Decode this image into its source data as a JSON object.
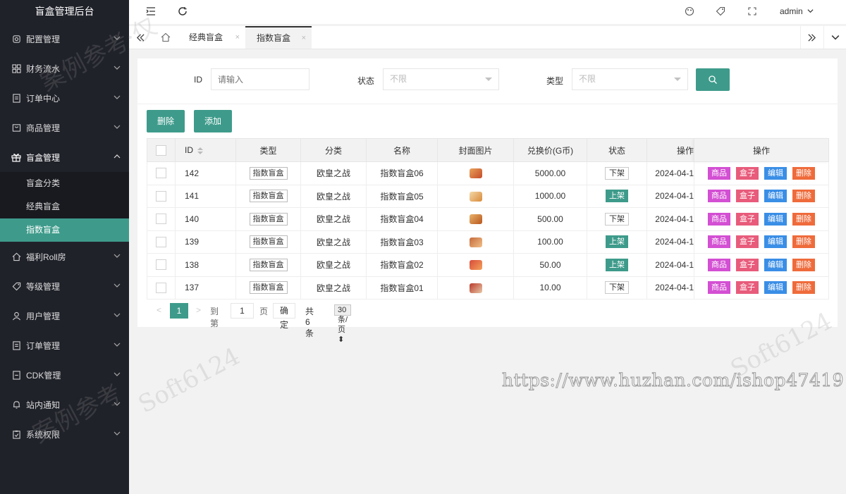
{
  "app": {
    "title": "盲盒管理后台"
  },
  "sidebar": {
    "items": [
      {
        "label": "配置管理",
        "icon": "gear-icon"
      },
      {
        "label": "财务流水",
        "icon": "grid-icon"
      },
      {
        "label": "订单中心",
        "icon": "doc-icon"
      },
      {
        "label": "商品管理",
        "icon": "bag-icon"
      },
      {
        "label": "盲盒管理",
        "icon": "gift-icon"
      },
      {
        "label": "福利Roll房",
        "icon": "home-icon"
      },
      {
        "label": "等级管理",
        "icon": "tag-icon"
      },
      {
        "label": "用户管理",
        "icon": "user-icon"
      },
      {
        "label": "订单管理",
        "icon": "doc-icon"
      },
      {
        "label": "CDK管理",
        "icon": "card-icon"
      },
      {
        "label": "站内通知",
        "icon": "bell-icon"
      },
      {
        "label": "系统权限",
        "icon": "clipboard-icon"
      }
    ],
    "sub_items": [
      "盲盒分类",
      "经典盲盒",
      "指数盲盒"
    ]
  },
  "header": {
    "user": "admin"
  },
  "tabs": [
    {
      "label": "经典盲盒"
    },
    {
      "label": "指数盲盒"
    }
  ],
  "tab_close": "×",
  "filters": {
    "id_label": "ID",
    "id_placeholder": "请输入",
    "status_label": "状态",
    "status_value": "不限",
    "type_label": "类型",
    "type_value": "不限"
  },
  "toolbar": {
    "delete_label": "删除",
    "add_label": "添加"
  },
  "table": {
    "headers": [
      "ID",
      "类型",
      "分类",
      "名称",
      "封面图片",
      "兑换价(G币)",
      "状态",
      "操作",
      "操作"
    ],
    "rows": [
      {
        "id": "142",
        "type": "指数盲盒",
        "category": "欧皇之战",
        "name": "指数盲盒06",
        "price": "5000.00",
        "status": "下架",
        "date": "2024-04-1"
      },
      {
        "id": "141",
        "type": "指数盲盒",
        "category": "欧皇之战",
        "name": "指数盲盒05",
        "price": "1000.00",
        "status": "上架",
        "date": "2024-04-1"
      },
      {
        "id": "140",
        "type": "指数盲盒",
        "category": "欧皇之战",
        "name": "指数盲盒04",
        "price": "500.00",
        "status": "下架",
        "date": "2024-04-1"
      },
      {
        "id": "139",
        "type": "指数盲盒",
        "category": "欧皇之战",
        "name": "指数盲盒03",
        "price": "100.00",
        "status": "上架",
        "date": "2024-04-1"
      },
      {
        "id": "138",
        "type": "指数盲盒",
        "category": "欧皇之战",
        "name": "指数盲盒02",
        "price": "50.00",
        "status": "上架",
        "date": "2024-04-1"
      },
      {
        "id": "137",
        "type": "指数盲盒",
        "category": "欧皇之战",
        "name": "指数盲盒01",
        "price": "10.00",
        "status": "下架",
        "date": "2024-04-1"
      }
    ],
    "actions": [
      {
        "label": "商品",
        "color": "#d34fd3"
      },
      {
        "label": "盒子",
        "color": "#e85b7b"
      },
      {
        "label": "编辑",
        "color": "#3a8ee6"
      },
      {
        "label": "删除",
        "color": "#ef6b3b"
      }
    ]
  },
  "pager": {
    "current": "1",
    "goto_label": "到第",
    "goto_value": "1",
    "page_label": "页",
    "confirm_label": "确定",
    "total_label": "共 6 条",
    "per_page": "30 条/页"
  },
  "watermark": {
    "url": "https://www.huzhan.com/ishop47419",
    "text1": "案例参考·仅",
    "text2": "Soft6124",
    "text3": "案例参考",
    "text4": "Soft6124"
  },
  "colors": {
    "accent": "#3e9b8b",
    "sidebar": "#20222a"
  }
}
